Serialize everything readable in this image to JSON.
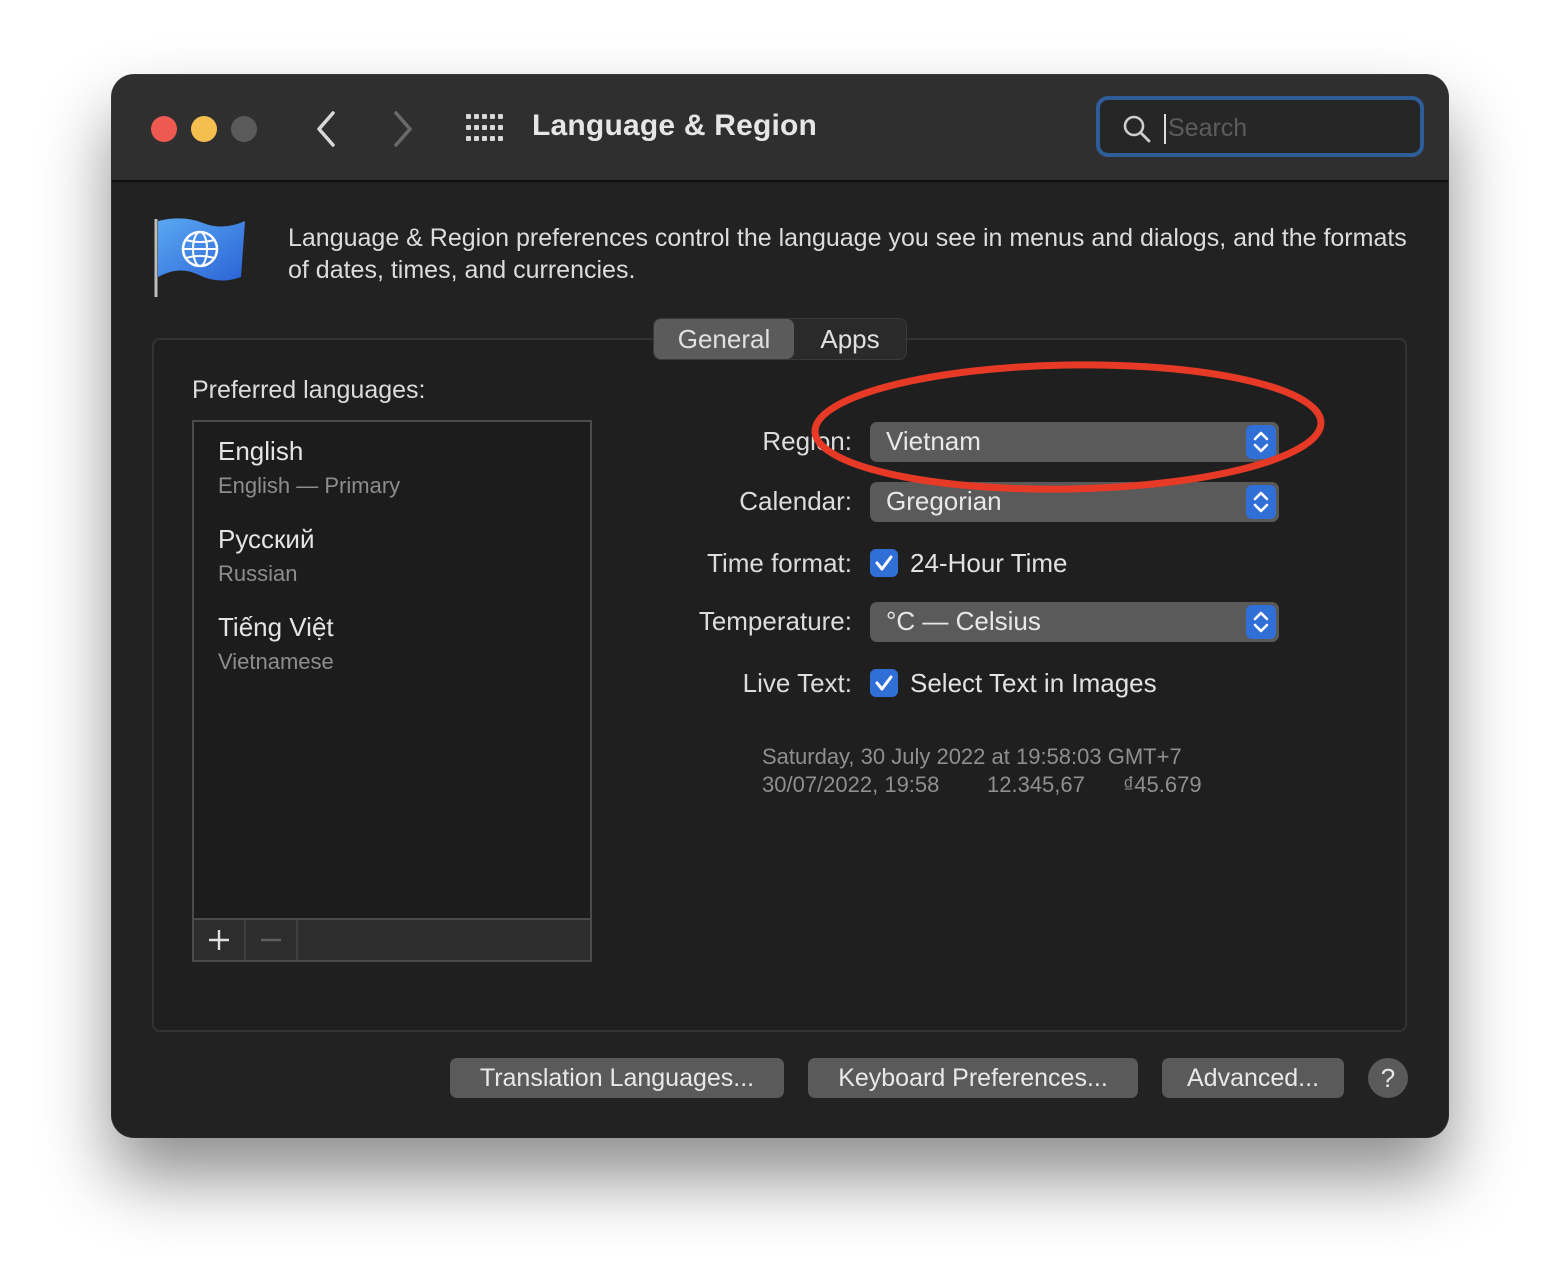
{
  "window": {
    "title": "Language & Region",
    "search_placeholder": "Search"
  },
  "header": {
    "description": "Language & Region preferences control the language you see in menus and dialogs, and the formats of dates, times, and currencies."
  },
  "tabs": [
    {
      "label": "General",
      "selected": true
    },
    {
      "label": "Apps",
      "selected": false
    }
  ],
  "preferred_languages": {
    "label": "Preferred languages:",
    "items": [
      {
        "name": "English",
        "detail": "English — Primary"
      },
      {
        "name": "Русский",
        "detail": "Russian"
      },
      {
        "name": "Tiếng Việt",
        "detail": "Vietnamese"
      }
    ],
    "add_label": "+",
    "remove_label": "—"
  },
  "settings": {
    "region_label": "Region:",
    "region_value": "Vietnam",
    "calendar_label": "Calendar:",
    "calendar_value": "Gregorian",
    "time_format_label": "Time format:",
    "time_format_option": "24-Hour Time",
    "time_format_checked": true,
    "temperature_label": "Temperature:",
    "temperature_value": "°C — Celsius",
    "live_text_label": "Live Text:",
    "live_text_option": "Select Text in Images",
    "live_text_checked": true
  },
  "sample": {
    "line1": "Saturday, 30 July 2022 at 19:58:03 GMT+7",
    "date_time": "30/07/2022, 19:58",
    "number": "12.345,67",
    "currency": "₫45.679"
  },
  "buttons": {
    "translation": "Translation Languages...",
    "keyboard": "Keyboard Preferences...",
    "advanced": "Advanced...",
    "help": "?"
  },
  "colors": {
    "accent": "#2f6fd6",
    "annotation": "#e63a27"
  }
}
